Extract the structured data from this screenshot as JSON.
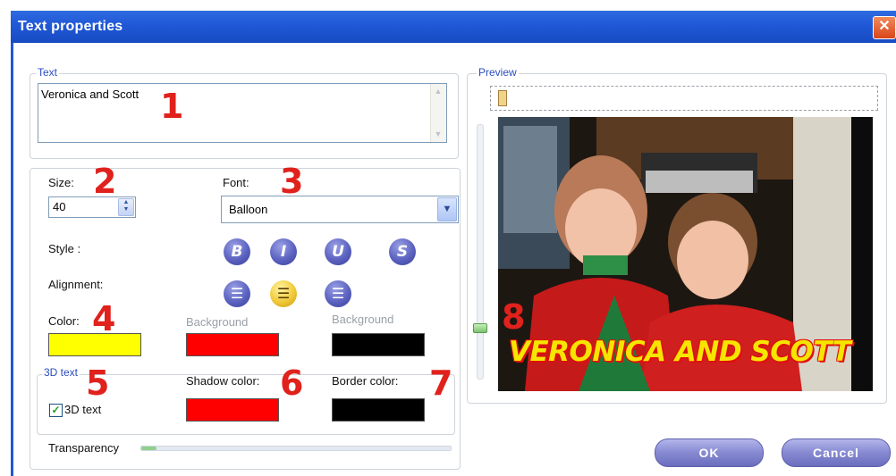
{
  "window": {
    "title": "Text properties",
    "close_glyph": "✕"
  },
  "text_group": {
    "legend": "Text",
    "value": "Veronica and Scott"
  },
  "size": {
    "label": "Size:",
    "value": "40"
  },
  "font": {
    "label": "Font:",
    "value": "Balloon"
  },
  "style": {
    "label": "Style :",
    "buttons": [
      "B",
      "I",
      "U",
      "S"
    ]
  },
  "alignment": {
    "label": "Alignment:",
    "options": [
      "left",
      "center",
      "right"
    ],
    "selected": "center"
  },
  "colors": {
    "color_label": "Color:",
    "color_value": "#ffff00",
    "background1_label": "Background",
    "background1_value": "#ff0000",
    "background2_label": "Background",
    "background2_value": "#000000"
  },
  "text3d": {
    "legend": "3D text",
    "checkbox_label": "3D text",
    "checked": true,
    "shadow_label": "Shadow color:",
    "shadow_value": "#ff0000",
    "border_label": "Border color:",
    "border_value": "#000000"
  },
  "transparency": {
    "label": "Transparency",
    "level_fraction": 0.05
  },
  "preview": {
    "legend": "Preview",
    "caption": "VERONICA AND SCOTT",
    "slider_level_fraction": 0.22
  },
  "callouts": [
    "1",
    "2",
    "3",
    "4",
    "5",
    "6",
    "7",
    "8"
  ],
  "buttons": {
    "ok": "OK",
    "cancel": "Cancel"
  },
  "icons": {
    "close": "close-icon",
    "spin": "spinner-icon",
    "dropdown": "chevron-down-icon"
  }
}
